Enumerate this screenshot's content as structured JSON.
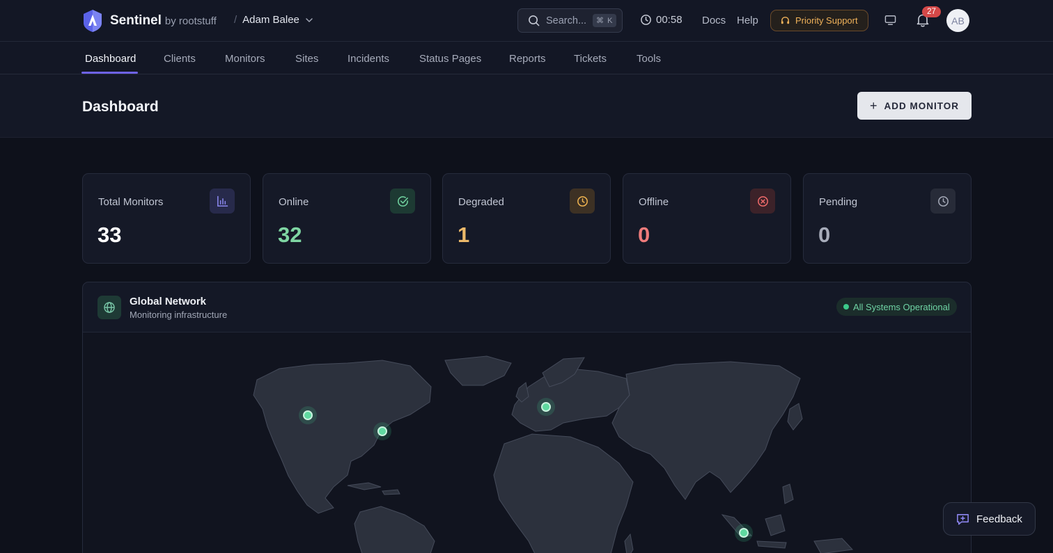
{
  "brand": {
    "name": "Sentinel",
    "by": "by rootstuff"
  },
  "breadcrumb": {
    "separator": "/",
    "user": "Adam Balee"
  },
  "search": {
    "placeholder": "Search...",
    "shortcut": "⌘ K"
  },
  "timer": "00:58",
  "toplinks": {
    "docs": "Docs",
    "help": "Help"
  },
  "support_label": "Priority Support",
  "notifications": {
    "count": "27"
  },
  "avatar_initials": "AB",
  "nav": {
    "tabs": [
      {
        "label": "Dashboard"
      },
      {
        "label": "Clients"
      },
      {
        "label": "Monitors"
      },
      {
        "label": "Sites"
      },
      {
        "label": "Incidents"
      },
      {
        "label": "Status Pages"
      },
      {
        "label": "Reports"
      },
      {
        "label": "Tickets"
      },
      {
        "label": "Tools"
      }
    ],
    "active": "Dashboard"
  },
  "page": {
    "title": "Dashboard",
    "add_button": "ADD MONITOR"
  },
  "stats": [
    {
      "label": "Total Monitors",
      "value": "33",
      "icon": "bar-chart-icon",
      "color": "#ffffff"
    },
    {
      "label": "Online",
      "value": "32",
      "icon": "check-circle-icon",
      "color": "#7fd6a3"
    },
    {
      "label": "Degraded",
      "value": "1",
      "icon": "clock-icon",
      "color": "#ecb96a"
    },
    {
      "label": "Offline",
      "value": "0",
      "icon": "x-circle-icon",
      "color": "#ee7b7b"
    },
    {
      "label": "Pending",
      "value": "0",
      "icon": "clock-icon",
      "color": "#a7acba"
    }
  ],
  "network": {
    "title": "Global Network",
    "subtitle": "Monitoring infrastructure",
    "status": "All Systems Operational",
    "status_color": "#3cc98a"
  },
  "feedback_label": "Feedback",
  "colors": {
    "accent": "#6e62e5",
    "support": "#f0b25a",
    "badge": "#d44848"
  }
}
